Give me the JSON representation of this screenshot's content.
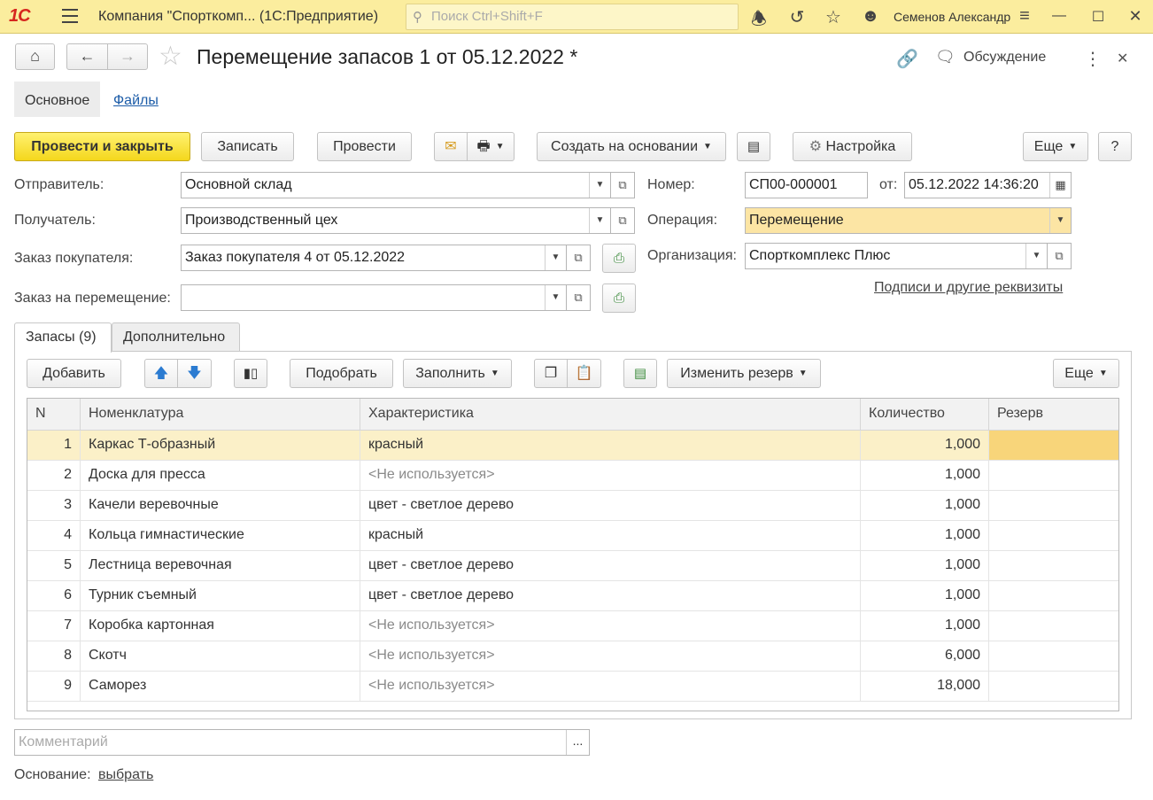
{
  "titlebar": {
    "logo": "1С",
    "app_title": "Компания \"Спорткомп...  (1С:Предприятие)",
    "search_placeholder": "Поиск Ctrl+Shift+F",
    "user": "Семенов Александр"
  },
  "document": {
    "title": "Перемещение запасов 1 от 05.12.2022 *",
    "discussion_label": "Обсуждение"
  },
  "form_tabs": {
    "main": "Основное",
    "files": "Файлы"
  },
  "toolbar": {
    "post_close": "Провести и закрыть",
    "save": "Записать",
    "post": "Провести",
    "create_based": "Создать на основании",
    "settings": "Настройка",
    "more": "Еще",
    "help": "?"
  },
  "fields": {
    "sender_label": "Отправитель:",
    "sender_value": "Основной склад",
    "receiver_label": "Получатель:",
    "receiver_value": "Производственный цех",
    "customer_order_label": "Заказ покупателя:",
    "customer_order_value": "Заказ покупателя 4 от 05.12.2022",
    "transfer_order_label": "Заказ на перемещение:",
    "transfer_order_value": "",
    "number_label": "Номер:",
    "number_value": "СП00-000001",
    "date_label": "от:",
    "date_value": "05.12.2022 14:36:20",
    "operation_label": "Операция:",
    "operation_value": "Перемещение",
    "org_label": "Организация:",
    "org_value": "Спорткомплекс Плюс",
    "signatures_link": "Подписи и другие реквизиты"
  },
  "panel_tabs": {
    "stocks": "Запасы (9)",
    "additional": "Дополнительно"
  },
  "table_toolbar": {
    "add": "Добавить",
    "pick": "Подобрать",
    "fill": "Заполнить",
    "change_reserve": "Изменить резерв",
    "more": "Еще"
  },
  "table": {
    "columns": [
      "N",
      "Номенклатура",
      "Характеристика",
      "Количество",
      "Резерв"
    ],
    "rows": [
      {
        "n": "1",
        "name": "Каркас Т-образный",
        "char": "красный",
        "qty": "1,000",
        "reserve": ""
      },
      {
        "n": "2",
        "name": "Доска для пресса",
        "char": "<Не используется>",
        "qty": "1,000",
        "reserve": ""
      },
      {
        "n": "3",
        "name": "Качели веревочные",
        "char": "цвет - светлое дерево",
        "qty": "1,000",
        "reserve": ""
      },
      {
        "n": "4",
        "name": "Кольца гимнастические",
        "char": "красный",
        "qty": "1,000",
        "reserve": ""
      },
      {
        "n": "5",
        "name": "Лестница веревочная",
        "char": "цвет - светлое дерево",
        "qty": "1,000",
        "reserve": ""
      },
      {
        "n": "6",
        "name": "Турник съемный",
        "char": "цвет - светлое дерево",
        "qty": "1,000",
        "reserve": ""
      },
      {
        "n": "7",
        "name": "Коробка картонная",
        "char": "<Не используется>",
        "qty": "1,000",
        "reserve": ""
      },
      {
        "n": "8",
        "name": "Скотч",
        "char": "<Не используется>",
        "qty": "6,000",
        "reserve": ""
      },
      {
        "n": "9",
        "name": "Саморез",
        "char": "<Не используется>",
        "qty": "18,000",
        "reserve": ""
      }
    ]
  },
  "footer": {
    "comment_placeholder": "Комментарий",
    "comment_button": "...",
    "basis_label": "Основание:",
    "basis_link": "выбрать"
  }
}
